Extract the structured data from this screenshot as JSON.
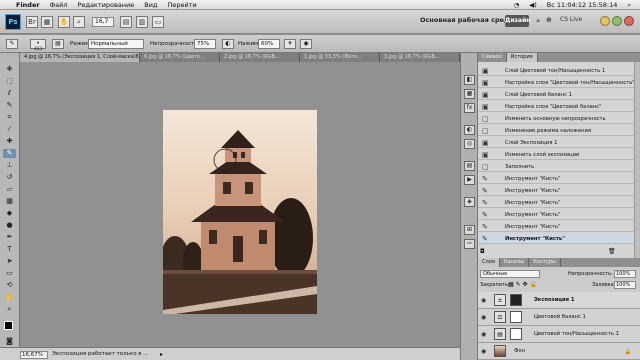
{
  "menubar": {
    "app": "Finder",
    "items": [
      "Файл",
      "Редактирование",
      "Вид",
      "Перейти"
    ],
    "clock": "Вс 11:04:12 15:58:14"
  },
  "appbar": {
    "logo": "Ps",
    "zoom": "16,7",
    "workspace": "Основная рабочая среда",
    "design_btn": "Дизайн",
    "cslive": "CS Live"
  },
  "options": {
    "brush_size": "411",
    "mode_label": "Режим:",
    "mode_value": "Нормальный",
    "opacity_label": "Непрозрачность:",
    "opacity_value": "75%",
    "flow_label": "Нажим:",
    "flow_value": "60%"
  },
  "doc_tabs": [
    "4.jpg @ 16,7% (Экспозиция 1, Слой-маска/8) *",
    "6.jpg @ 16,7% (Цвето...",
    "2.jpg @ 16,7% (RGB...",
    "1.jpg @ 33,3% (Фото...",
    "3.jpg @ 16,7% (RGB..."
  ],
  "status": {
    "zoom": "16,67%",
    "message": "Экспозиция работает только в ..."
  },
  "history_tabs": [
    "Символ",
    "История"
  ],
  "history": [
    "Слой Цветовой тон/Насыщенность 1",
    "Настройка слоя \"Цветовой тон/Насыщенность\"",
    "Слой Цветовой баланс 1",
    "Настройка слоя \"Цветовой баланс\"",
    "Изменить основную непрозрачность",
    "Изменение режима наложения",
    "Слой Экспозиция 1",
    "Изменить слой экспозиции",
    "Заполнить",
    "Инструмент \"Кисть\"",
    "Инструмент \"Кисть\"",
    "Инструмент \"Кисть\"",
    "Инструмент \"Кисть\"",
    "Инструмент \"Кисть\"",
    "Инструмент \"Кисть\""
  ],
  "layers_tabs": [
    "Слои",
    "Каналы",
    "Контуры"
  ],
  "layers": {
    "blend_mode": "Обычные",
    "opacity_label": "Непрозрачность:",
    "opacity_value": "100%",
    "lock_label": "Закрепить:",
    "fill_label": "Заливка:",
    "fill_value": "100%",
    "items": [
      "Экспозиция 1",
      "Цветовой баланс 1",
      "Цветовой тон/Насыщенность 1",
      "Фон"
    ]
  }
}
